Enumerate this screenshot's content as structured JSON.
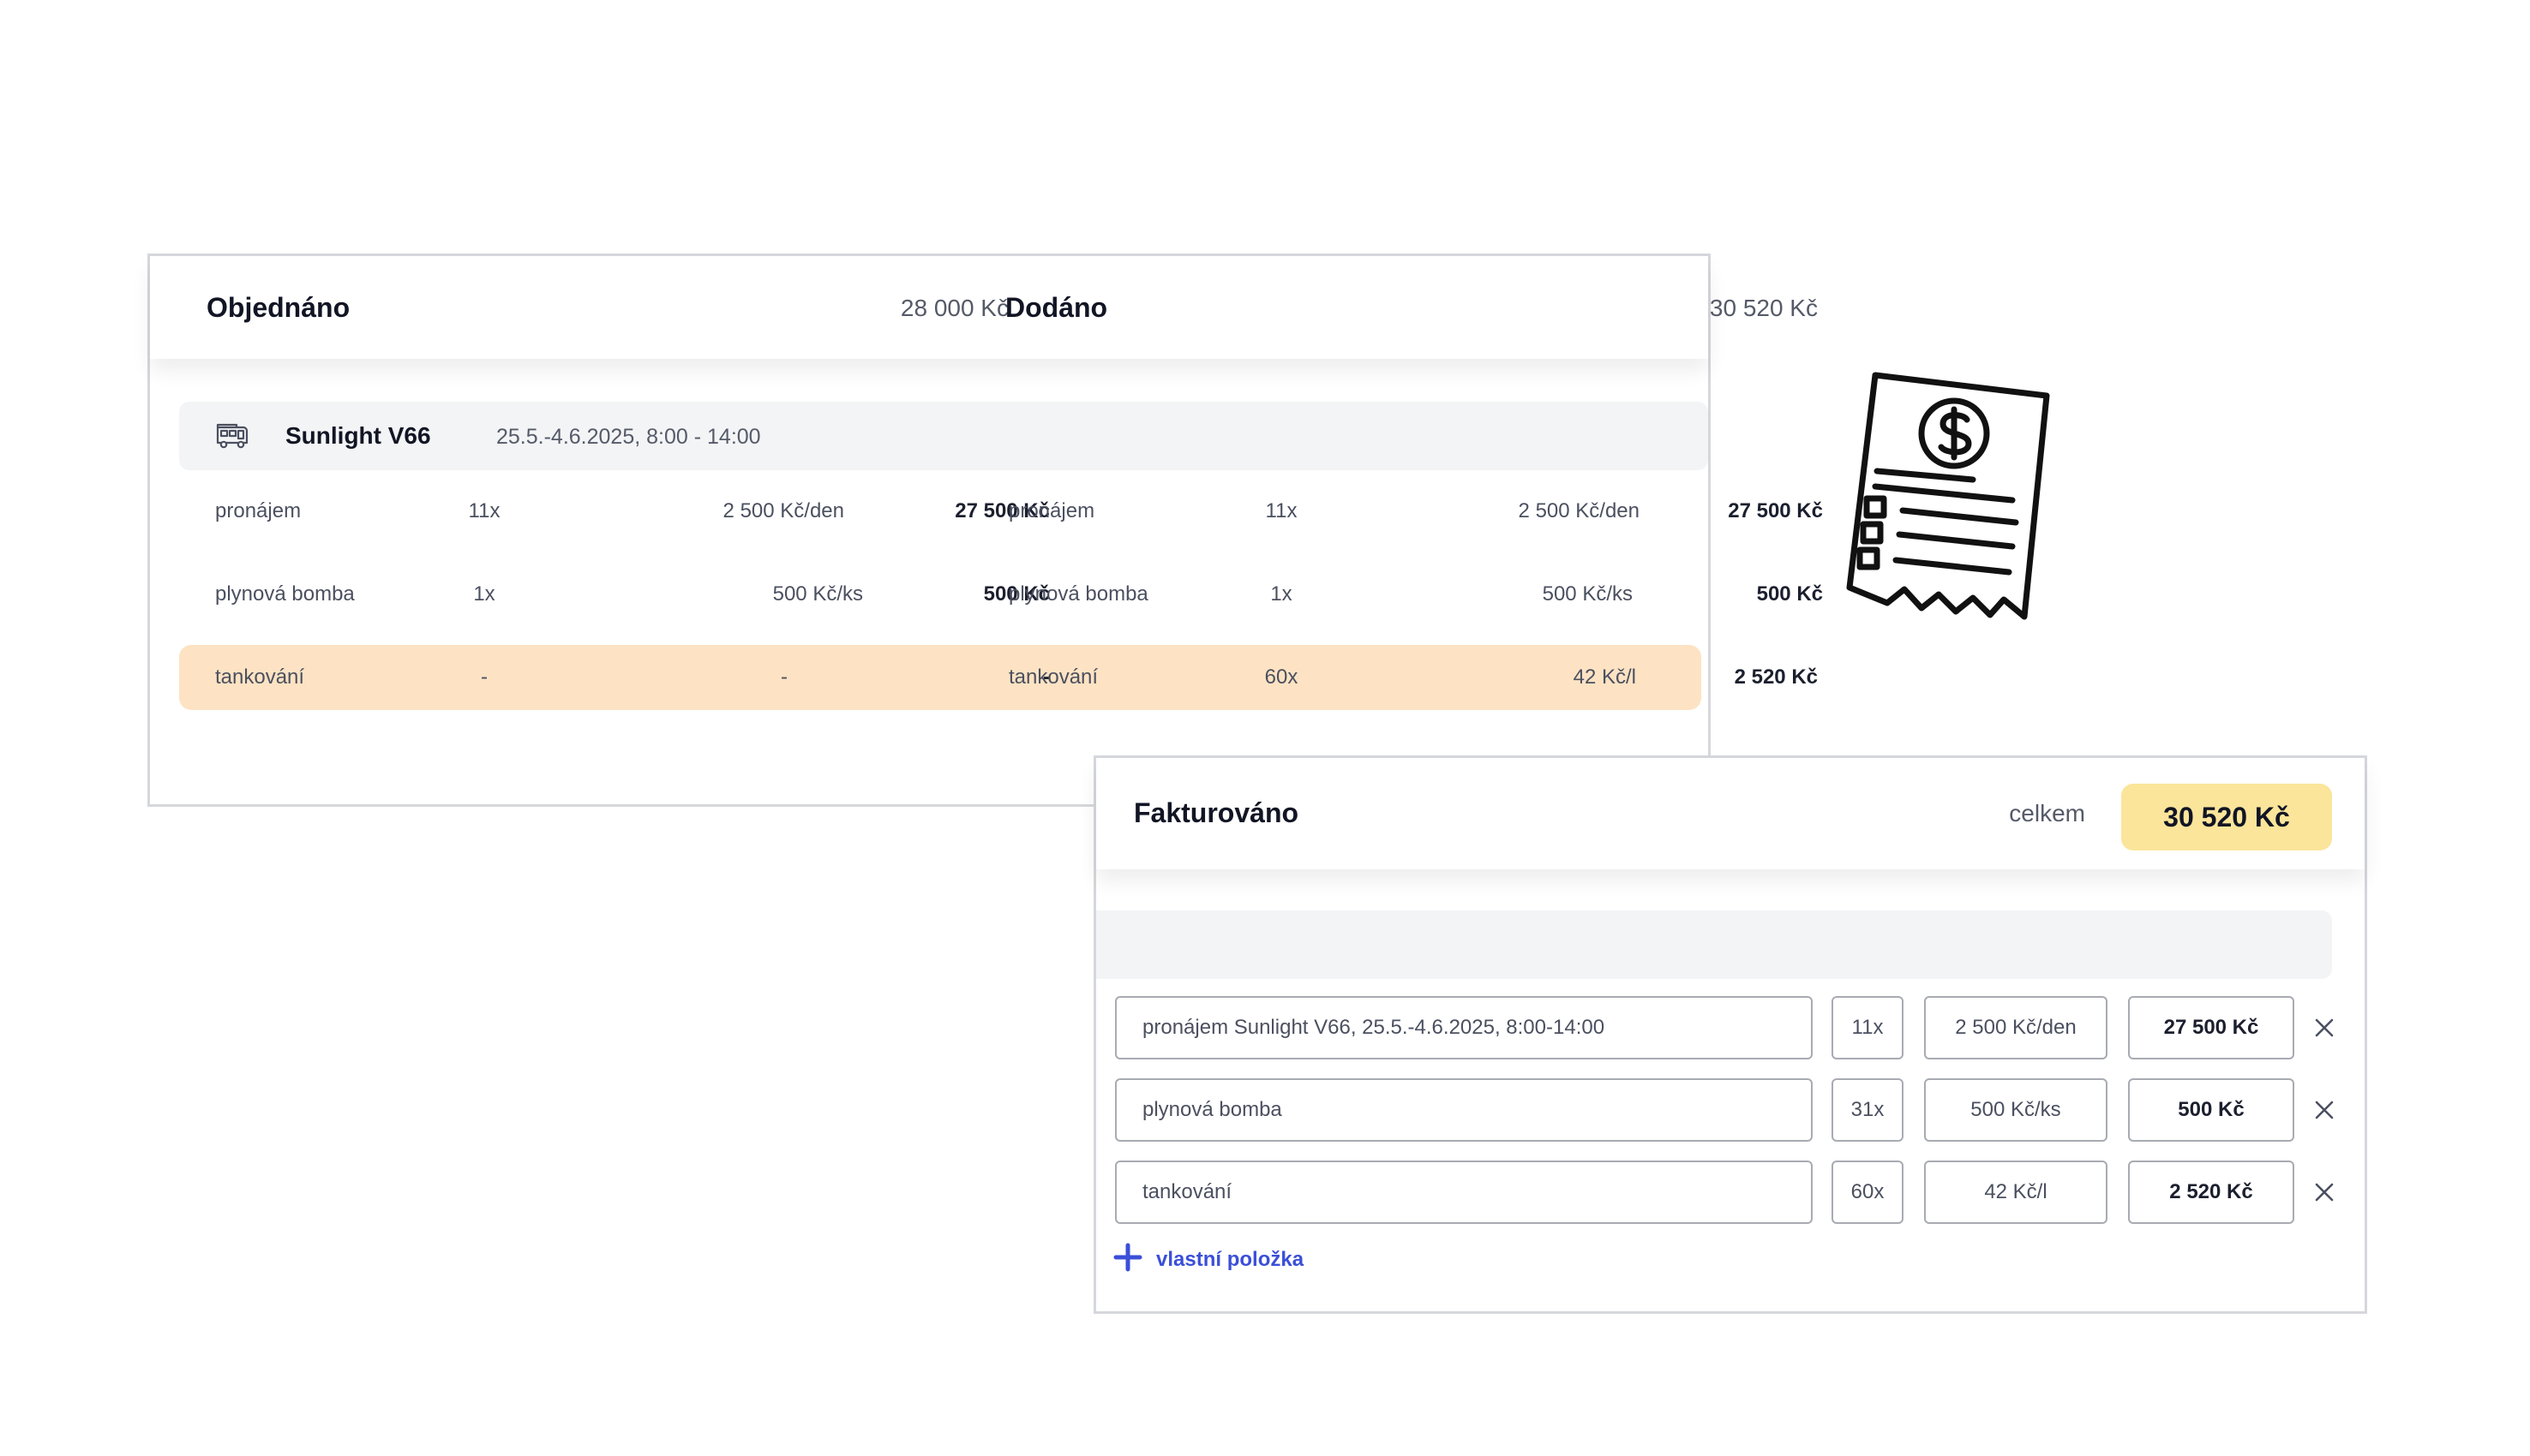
{
  "ordered": {
    "title": "Objednáno",
    "total": "28 000 Kč"
  },
  "delivered": {
    "title": "Dodáno",
    "total": "30 520 Kč"
  },
  "vehicle": {
    "icon": "camper-van-icon",
    "name": "Sunlight V66",
    "dates": "25.5.-4.6.2025, 8:00 - 14:00"
  },
  "ordered_rows": [
    {
      "item": "pronájem",
      "qty": "11x",
      "price": "2 500 Kč/den",
      "total": "27 500 Kč"
    },
    {
      "item": "plynová bomba",
      "qty": "1x",
      "price": "500 Kč/ks",
      "total": "500 Kč"
    },
    {
      "item": "tankování",
      "qty": "-",
      "price": "-",
      "total": "-"
    }
  ],
  "delivered_rows": [
    {
      "item": "pronájem",
      "qty": "11x",
      "price": "2 500 Kč/den",
      "total": "27 500 Kč"
    },
    {
      "item": "plynová bomba",
      "qty": "1x",
      "price": "500 Kč/ks",
      "total": "500 Kč"
    },
    {
      "item": "tankování",
      "qty": "60x",
      "price": "42 Kč/l",
      "total": "2 520 Kč"
    }
  ],
  "invoiced": {
    "title": "Fakturováno",
    "total_label": "celkem",
    "total": "30 520 Kč",
    "rows": [
      {
        "description": "pronájem Sunlight V66, 25.5.-4.6.2025, 8:00-14:00",
        "qty": "11x",
        "unit_price": "2 500 Kč/den",
        "total": "27 500 Kč"
      },
      {
        "description": "plynová bomba",
        "qty": "31x",
        "unit_price": "500 Kč/ks",
        "total": "500 Kč"
      },
      {
        "description": "tankování",
        "qty": "60x",
        "unit_price": "42 Kč/l",
        "total": "2 520 Kč"
      }
    ],
    "add_label": "vlastní položka"
  },
  "colors": {
    "highlight_row": "#fde3c3",
    "total_badge": "#fbe59a",
    "accent": "#3b4fd8",
    "border": "#d5d7dc"
  },
  "icons": {
    "receipt": "receipt-dollar-icon",
    "remove": "close-icon",
    "add": "plus-icon"
  }
}
